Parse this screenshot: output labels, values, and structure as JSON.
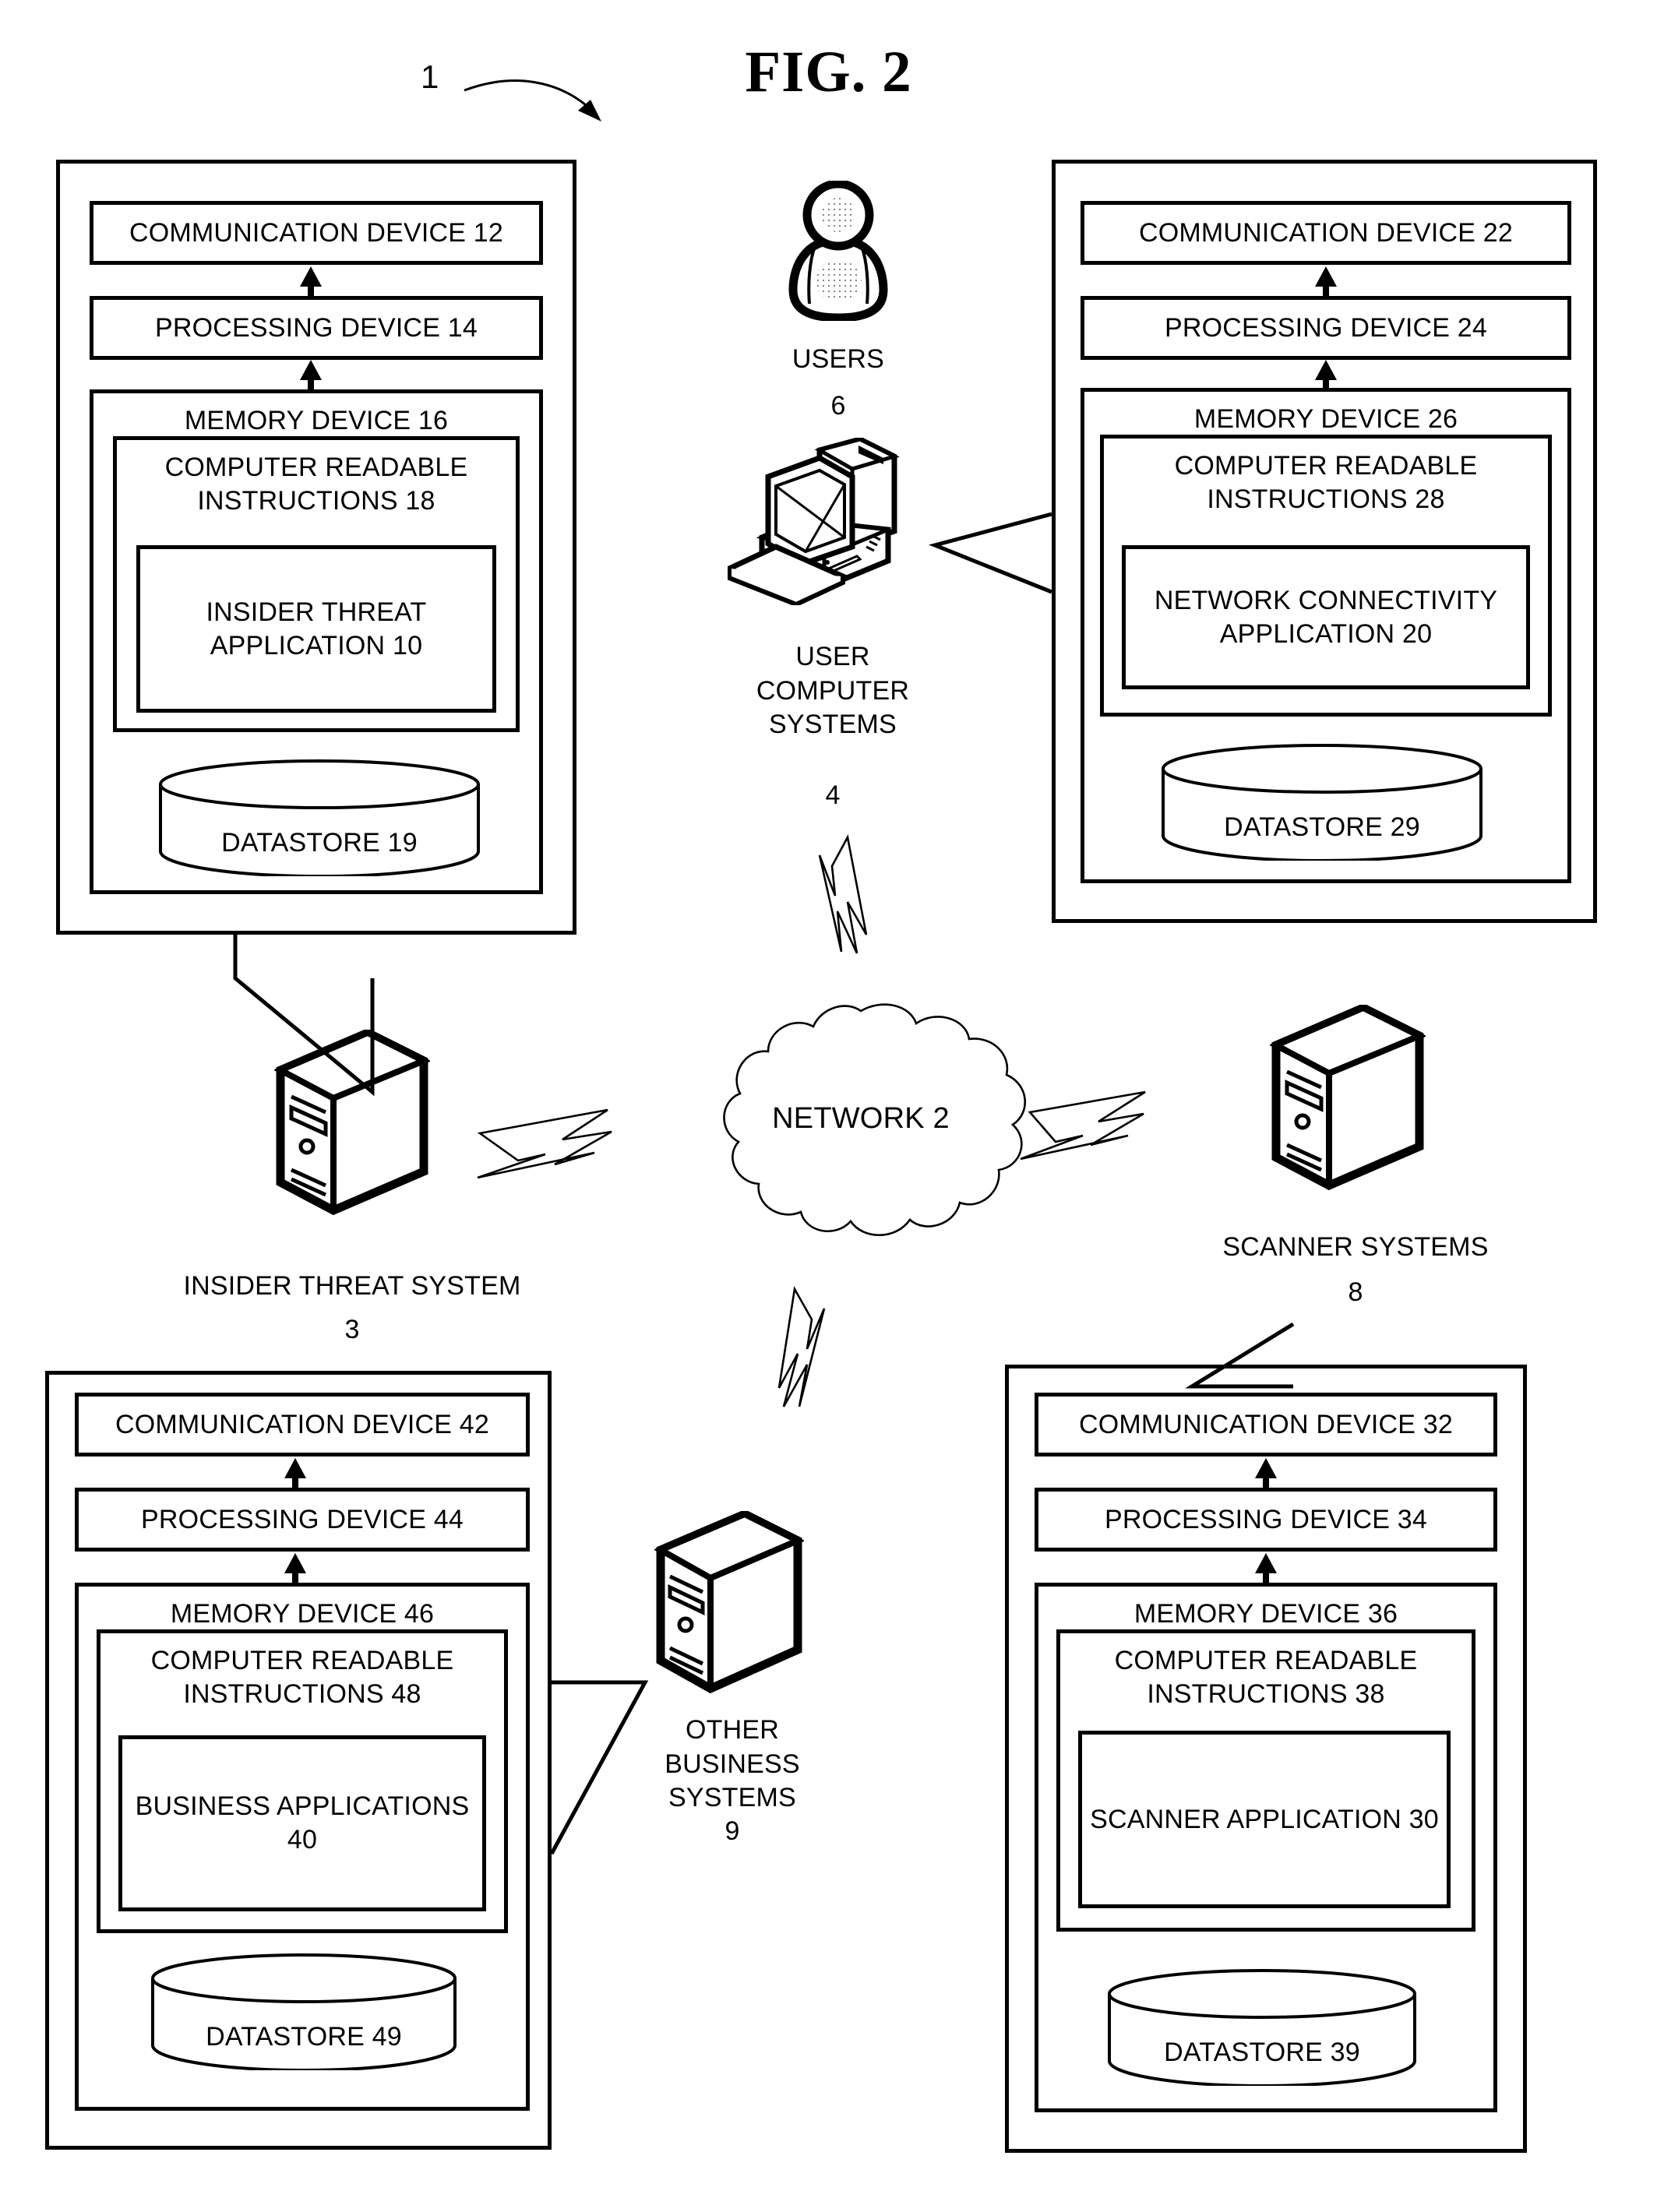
{
  "figure": {
    "title": "FIG. 2",
    "reference_numeral": "1"
  },
  "systems": {
    "insider_threat": {
      "communication_device": "COMMUNICATION DEVICE 12",
      "processing_device": "PROCESSING DEVICE 14",
      "memory_device": "MEMORY DEVICE 16",
      "instructions": "COMPUTER READABLE\nINSTRUCTIONS 18",
      "application": "INSIDER THREAT\nAPPLICATION\n10",
      "datastore": "DATASTORE 19",
      "label": "INSIDER THREAT SYSTEM",
      "label_number": "3"
    },
    "user_computer": {
      "communication_device": "COMMUNICATION DEVICE 22",
      "processing_device": "PROCESSING DEVICE 24",
      "memory_device": "MEMORY DEVICE 26",
      "instructions": "COMPUTER READABLE\nINSTRUCTIONS 28",
      "application": "NETWORK CONNECTIVITY\nAPPLICATION\n20",
      "datastore": "DATASTORE 29",
      "label": "USER\nCOMPUTER\nSYSTEMS",
      "label_number": "4"
    },
    "other_business": {
      "communication_device": "COMMUNICATION DEVICE 42",
      "processing_device": "PROCESSING DEVICE 44",
      "memory_device": "MEMORY DEVICE 46",
      "instructions": "COMPUTER READABLE\nINSTRUCTIONS 48",
      "application": "BUSINESS\nAPPLICATIONS\n40",
      "datastore": "DATASTORE 49",
      "label": "OTHER\nBUSINESS\nSYSTEMS",
      "label_number": "9"
    },
    "scanner": {
      "communication_device": "COMMUNICATION DEVICE 32",
      "processing_device": "PROCESSING DEVICE 34",
      "memory_device": "MEMORY DEVICE 36",
      "instructions": "COMPUTER READABLE\nINSTRUCTIONS 38",
      "application": "SCANNER\nAPPLICATION\n30",
      "datastore": "DATASTORE 39",
      "label": "SCANNER SYSTEMS",
      "label_number": "8"
    }
  },
  "users": {
    "label": "USERS",
    "label_number": "6"
  },
  "network": {
    "label": "NETWORK 2"
  },
  "icons": {
    "user": "user-person-icon",
    "desktop": "desktop-computer-icon",
    "server": "server-tower-icon",
    "cloud": "network-cloud-icon",
    "cylinder": "database-cylinder-icon",
    "lightning": "lightning-bolt-connector-icon",
    "arrow": "double-headed-arrow-icon",
    "callout": "callout-pointer-icon",
    "curved_arrow": "curved-leader-arrow-icon"
  },
  "colors": {
    "stroke": "#000000",
    "background": "#ffffff"
  }
}
